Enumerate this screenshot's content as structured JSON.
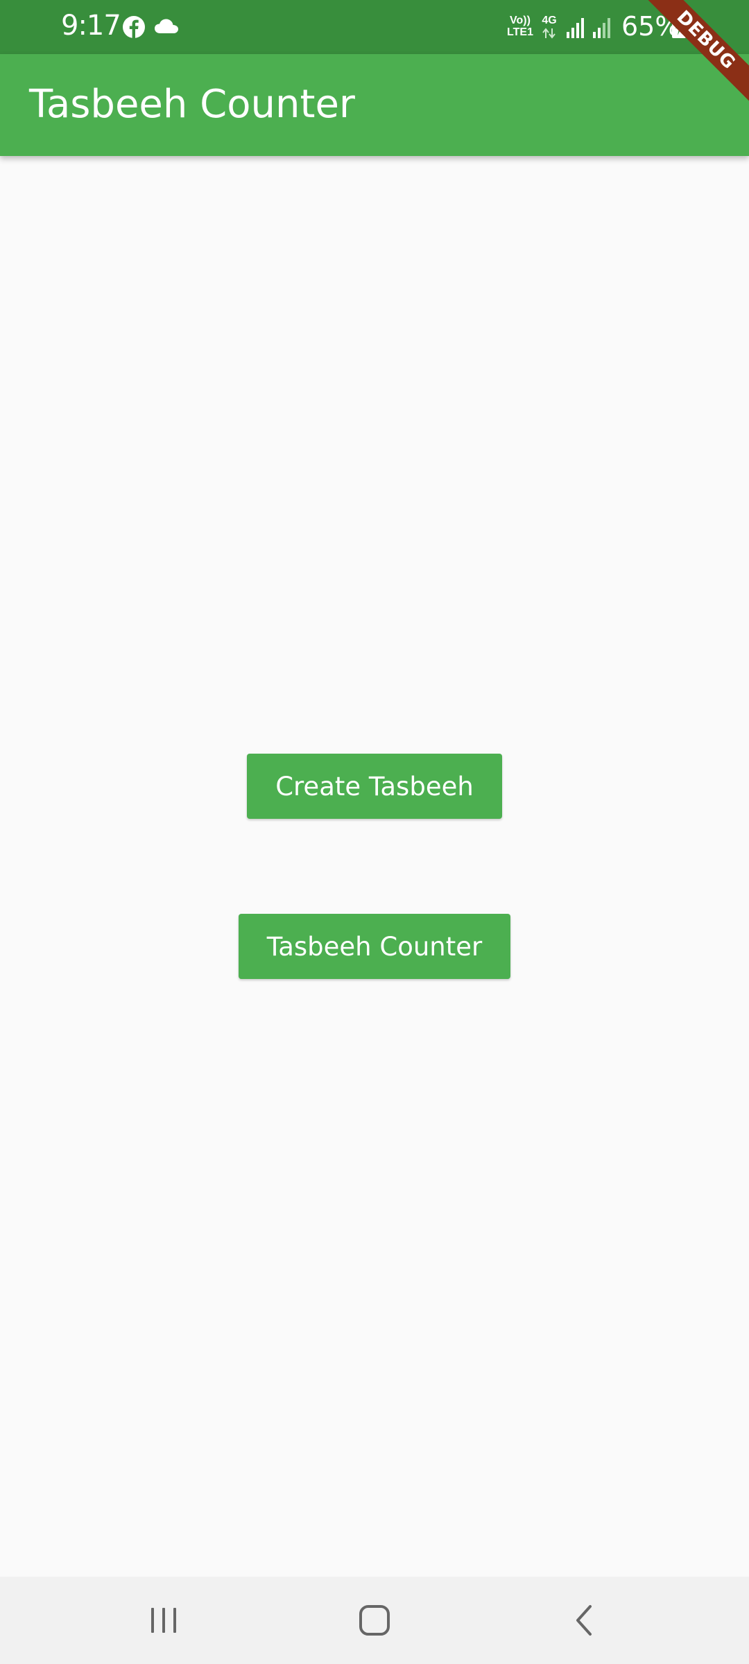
{
  "status_bar": {
    "time": "9:17",
    "network_top": "Vo))",
    "network_bottom": "LTE1",
    "data_type": "4G",
    "battery": "65%",
    "icons": [
      "facebook-icon",
      "cloud-icon",
      "signal-icon",
      "signal-icon",
      "battery-charging-icon"
    ]
  },
  "app_bar": {
    "title": "Tasbeeh Counter"
  },
  "debug_banner": "DEBUG",
  "main": {
    "create_button_label": "Create Tasbeeh",
    "counter_button_label": "Tasbeeh Counter"
  },
  "nav_bar": {
    "buttons": [
      "recent-apps-icon",
      "home-icon",
      "back-icon"
    ]
  },
  "colors": {
    "primary": "#4caf50",
    "status_bar": "#388e3c",
    "background": "#fafafa",
    "debug_ribbon": "#8b2f16"
  }
}
